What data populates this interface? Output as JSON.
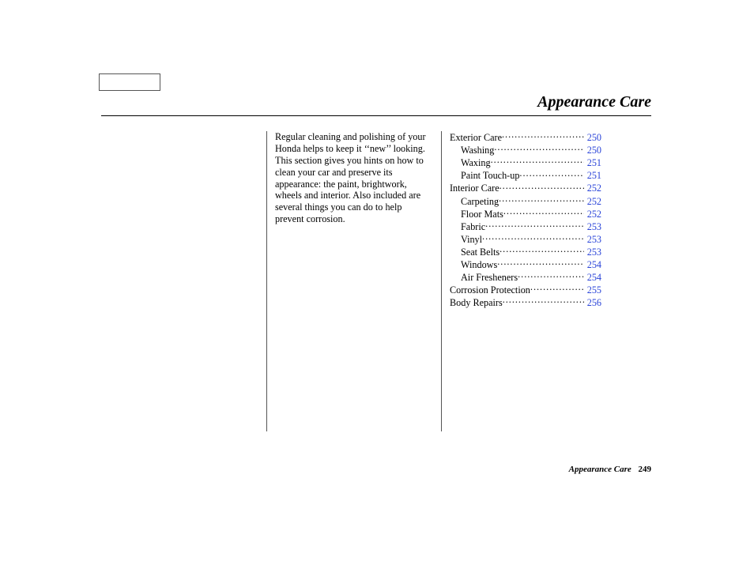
{
  "title": "Appearance Care",
  "intro": "Regular cleaning and polishing of your Honda helps to keep it ‘‘new’’ looking. This section gives you hints on how to clean your car and preserve its appearance: the paint, brightwork, wheels and interior. Also included are several things you can do to help prevent corrosion.",
  "toc": [
    {
      "label": "Exterior Care",
      "page": "250",
      "indent": false
    },
    {
      "label": "Washing",
      "page": "250",
      "indent": true
    },
    {
      "label": "Waxing",
      "page": "251",
      "indent": true
    },
    {
      "label": "Paint Touch-up",
      "page": "251",
      "indent": true
    },
    {
      "label": "Interior Care",
      "page": "252",
      "indent": false
    },
    {
      "label": "Carpeting",
      "page": "252",
      "indent": true
    },
    {
      "label": "Floor Mats",
      "page": "252",
      "indent": true
    },
    {
      "label": "Fabric",
      "page": "253",
      "indent": true
    },
    {
      "label": "Vinyl",
      "page": "253",
      "indent": true
    },
    {
      "label": "Seat Belts",
      "page": "253",
      "indent": true
    },
    {
      "label": "Windows",
      "page": "254",
      "indent": true
    },
    {
      "label": "Air Fresheners",
      "page": "254",
      "indent": true
    },
    {
      "label": "Corrosion Protection",
      "page": "255",
      "indent": false
    },
    {
      "label": "Body Repairs",
      "page": "256",
      "indent": false
    }
  ],
  "footer": {
    "section": "Appearance Care",
    "page": "249"
  }
}
